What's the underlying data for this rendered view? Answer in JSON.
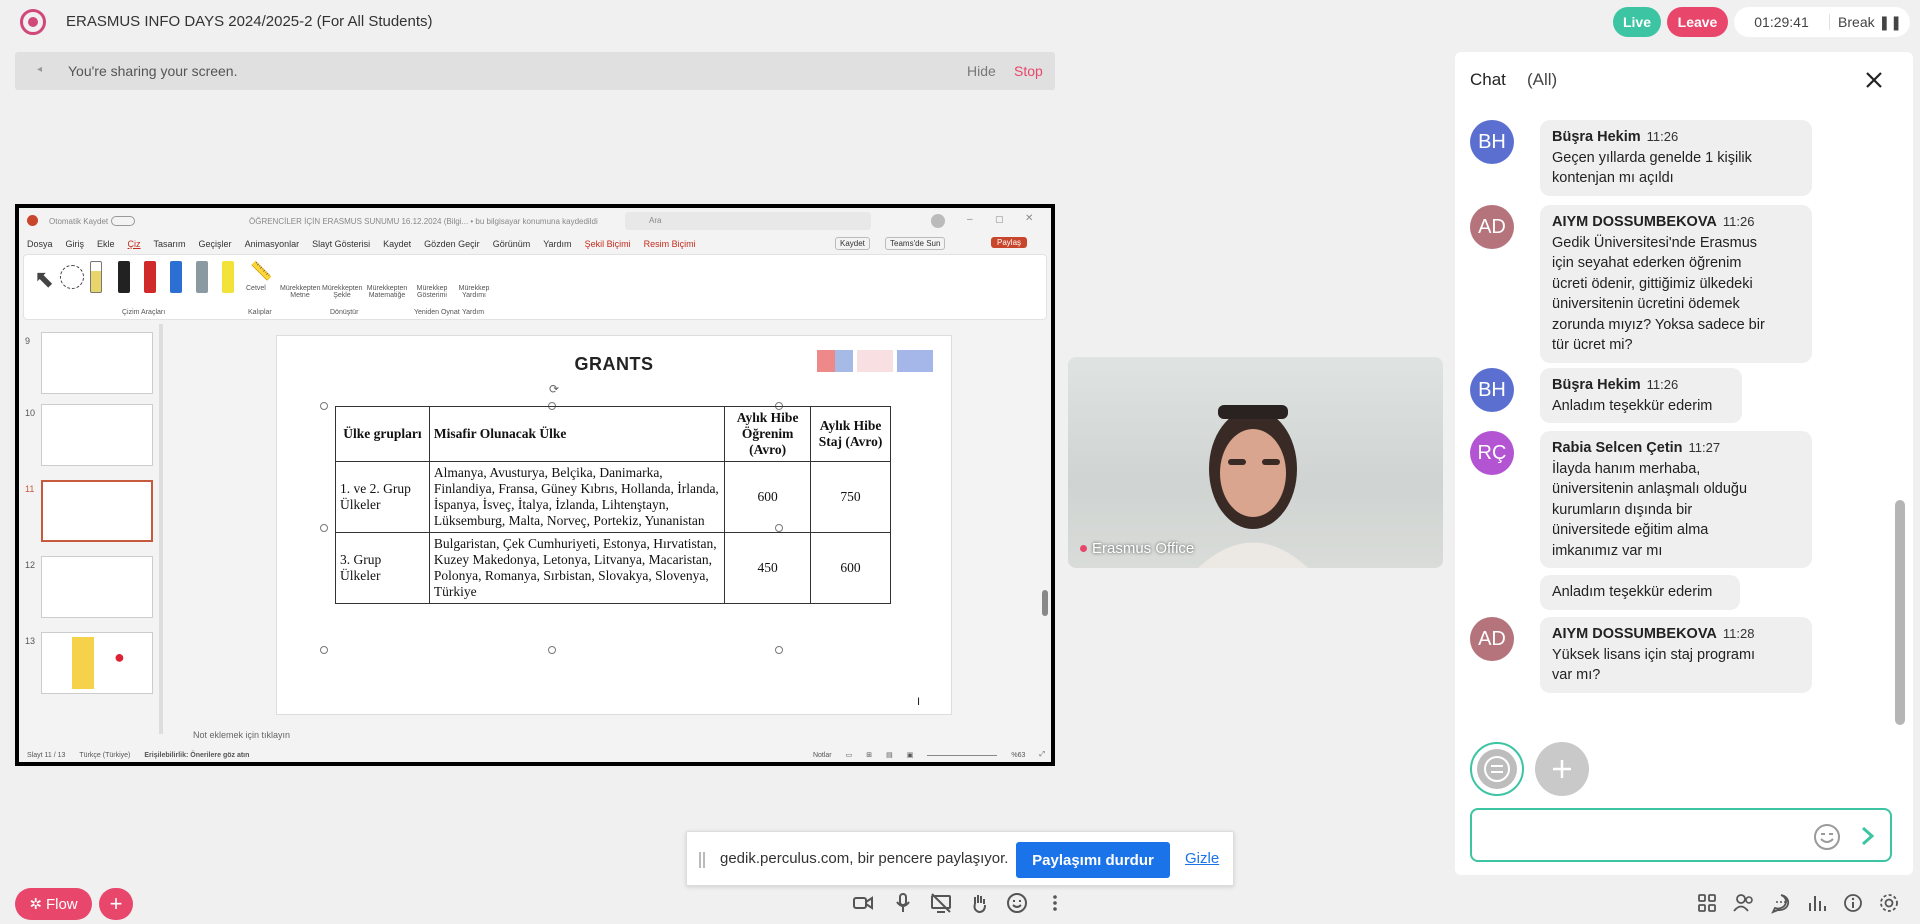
{
  "header": {
    "title": "ERASMUS INFO DAYS 2024/2025-2 (For All Students)",
    "live_label": "Live",
    "leave_label": "Leave",
    "timer": "01:29:41",
    "break_label": "Break"
  },
  "share_bar": {
    "text": "You're sharing your screen.",
    "hide_label": "Hide",
    "stop_label": "Stop"
  },
  "ppt": {
    "autosave": "Otomatik Kaydet",
    "window_title": "ÖĞRENCİLER İÇİN ERASMUS SUNUMU 16.12.2024 (Bilgi... • bu bilgisayar konumuna kaydedildi",
    "search": "Ara",
    "menu": [
      "Dosya",
      "Giriş",
      "Ekle",
      "Çiz",
      "Tasarım",
      "Geçişler",
      "Animasyonlar",
      "Slayt Gösterisi",
      "Kaydet",
      "Gözden Geçir",
      "Görünüm",
      "Yardım",
      "Şekil Biçimi",
      "Resim Biçimi"
    ],
    "right_buttons": [
      "Kaydet",
      "Teams'de Sun",
      "Paylaş"
    ],
    "ribbon": {
      "groups": [
        "Çizim Araçları",
        "Kalıplar",
        "Dönüştür",
        "Yeniden Oynat",
        "Yardım"
      ],
      "cetvel": "Cetvel",
      "ink_text": "Mürekkepten Metne",
      "ink_shape": "Mürekkepten Şekle",
      "ink_math": "Mürekkepten Matematiğe",
      "ink_replay": "Mürekkep Gösterimi",
      "ink_help": "Mürekkep Yardımı"
    },
    "thumbs": [
      "9",
      "10",
      "11",
      "12",
      "13"
    ],
    "slide": {
      "title": "GRANTS",
      "table": {
        "headers": [
          "Ülke grupları",
          "Misafir Olunacak Ülke",
          "Aylık Hibe Öğrenim (Avro)",
          "Aylık Hibe Staj (Avro)"
        ],
        "rows": [
          [
            "1. ve 2. Grup Ülkeler",
            "Almanya, Avusturya, Belçika, Danimarka, Finlandiya, Fransa, Güney Kıbrıs, Hollanda, İrlanda, İspanya, İsveç, İtalya, İzlanda, Lihtenştayn, Lüksemburg, Malta, Norveç, Portekiz, Yunanistan",
            "600",
            "750"
          ],
          [
            "3. Grup Ülkeler",
            "Bulgaristan, Çek Cumhuriyeti, Estonya, Hırvatistan, Kuzey Makedonya, Letonya, Litvanya, Macaristan, Polonya, Romanya, Sırbistan, Slovakya, Slovenya, Türkiye",
            "450",
            "600"
          ]
        ]
      }
    },
    "notes": "Not eklemek için tıklayın",
    "status": {
      "slide": "Slayt 11 / 13",
      "lang": "Türkçe (Türkiye)",
      "access": "Erişilebilirlik: Önerilere göz atın",
      "notes": "Notlar",
      "zoom": "%63"
    }
  },
  "video": {
    "name": "Erasmus Office"
  },
  "chat": {
    "title": "Chat",
    "scope": "(All)",
    "messages": [
      {
        "initials": "BH",
        "color": "#5b6fd1",
        "name": "Büşra Hekim",
        "time": "11:26",
        "lines": [
          "Geçen yıllarda genelde 1 kişilik",
          "kontenjan mı açıldı"
        ]
      },
      {
        "initials": "AD",
        "color": "#b5737c",
        "name": "AIYM DOSSUMBEKOVA",
        "time": "11:26",
        "lines": [
          "Gedik Üniversitesi'nde Erasmus",
          "için seyahat ederken öğrenim",
          "ücreti ödenir, gittiğimiz ülkedeki",
          "üniversitenin ücretini ödemek",
          "zorunda mıyız? Yoksa sadece bir",
          "tür ücret mi?"
        ]
      },
      {
        "initials": "BH",
        "color": "#5b6fd1",
        "name": "Büşra Hekim",
        "time": "11:26",
        "lines": [
          "Anladım teşekkür ederim"
        ]
      },
      {
        "initials": "RÇ",
        "color": "#b354d2",
        "name": "Rabia Selcen Çetin",
        "time": "11:27",
        "lines": [
          "İlayda hanım merhaba,",
          "üniversitenin anlaşmalı olduğu",
          "kurumların dışında bir",
          "üniversitede eğitim alma",
          "imkanımız var mı"
        ]
      },
      {
        "followup": "Anladım teşekkür ederim"
      },
      {
        "initials": "AD",
        "color": "#b5737c",
        "name": "AIYM DOSSUMBEKOVA",
        "time": "11:28",
        "lines": [
          "Yüksek lisans için staj programı",
          "var mı?"
        ]
      }
    ],
    "input_placeholder": ""
  },
  "notification": {
    "text": "gedik.perculus.com, bir pencere paylaşıyor.",
    "stop_label": "Paylaşımı durdur",
    "hide_label": "Gizle"
  },
  "bottom": {
    "flow_label": "Flow"
  },
  "colors": {
    "accent": "#3cc4a3",
    "danger": "#e8466b",
    "primary_blue": "#1a73e8"
  }
}
